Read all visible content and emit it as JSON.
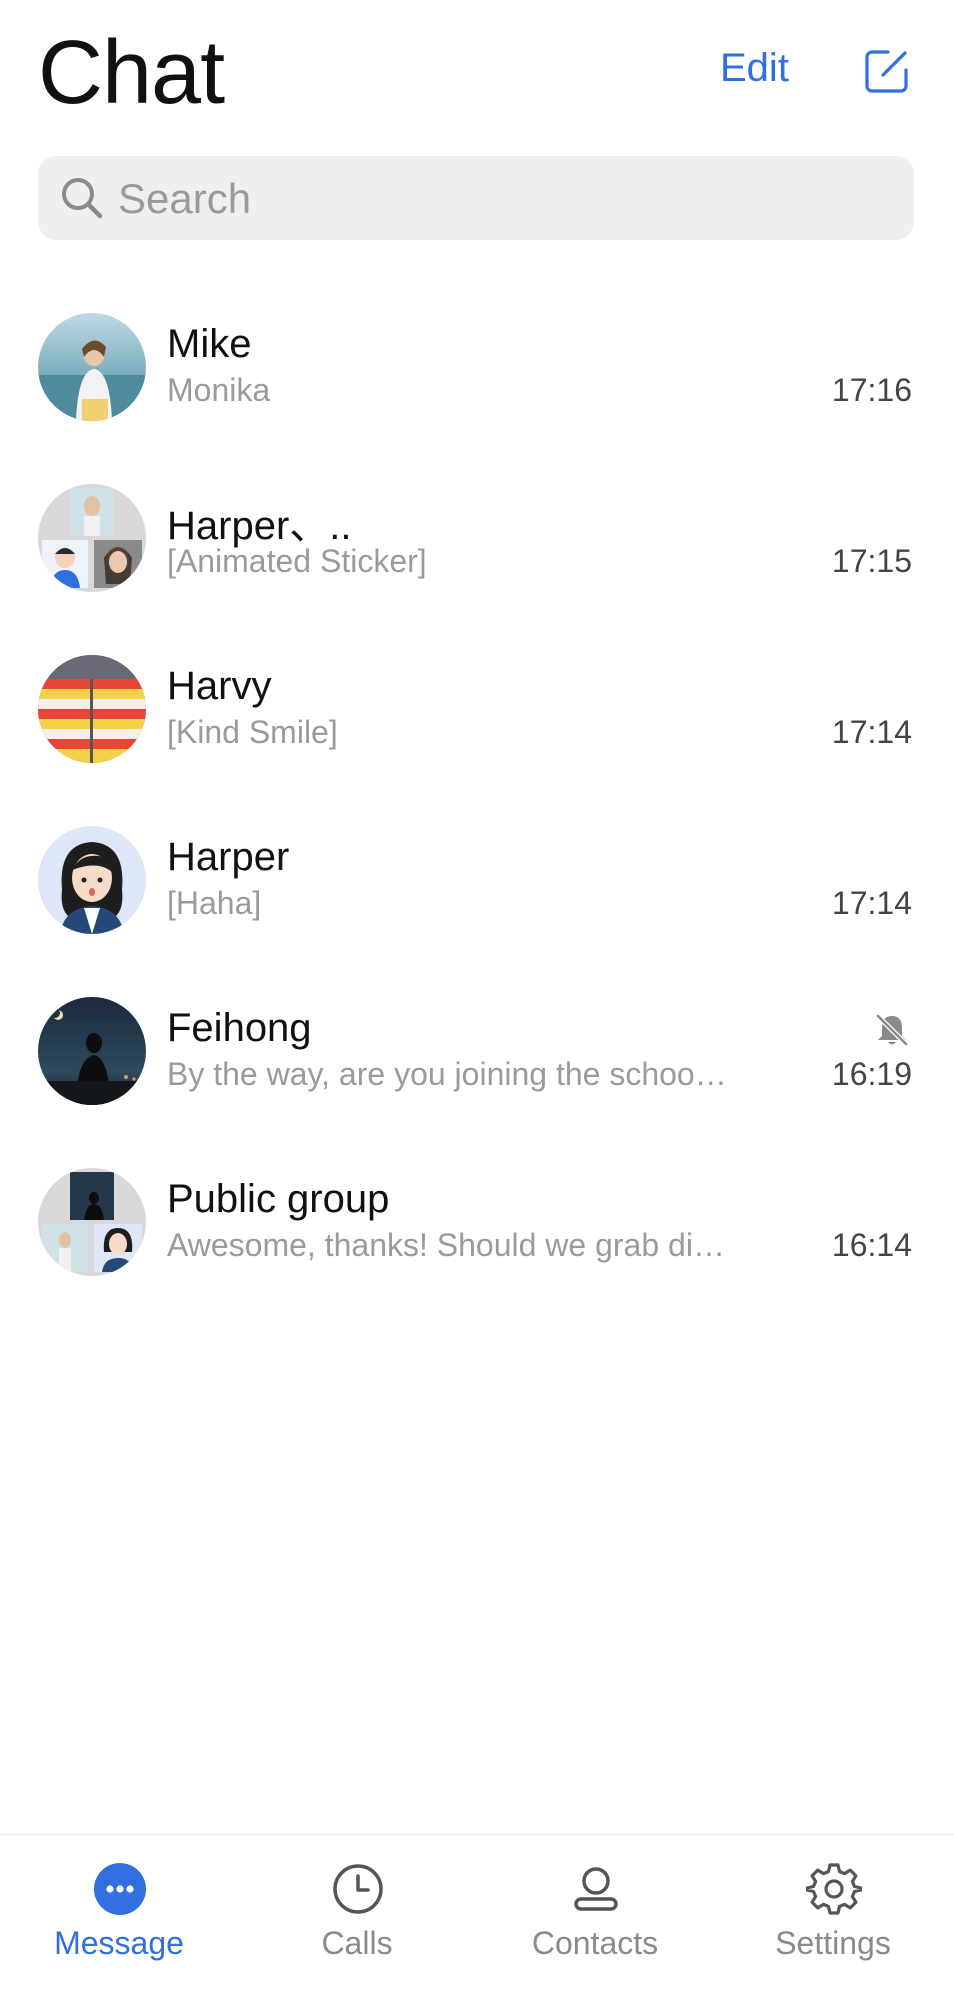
{
  "header": {
    "title": "Chat",
    "edit_label": "Edit",
    "compose_icon": "compose-icon"
  },
  "search": {
    "placeholder": "Search"
  },
  "chats": [
    {
      "name": "Mike",
      "preview": "Monika",
      "time": "17:16",
      "muted": false,
      "avatar": "photo-woman-beach"
    },
    {
      "name": "Harper、..",
      "preview": "[Animated Sticker]",
      "time": "17:15",
      "muted": false,
      "avatar": "group-collage"
    },
    {
      "name": "Harvy",
      "preview": "[Kind Smile]",
      "time": "17:14",
      "muted": false,
      "avatar": "striped-pattern"
    },
    {
      "name": "Harper",
      "preview": "[Haha]",
      "time": "17:14",
      "muted": false,
      "avatar": "cartoon-woman"
    },
    {
      "name": "Feihong",
      "preview": "By the way, are you joining the schoo…",
      "time": "16:19",
      "muted": true,
      "avatar": "night-silhouette"
    },
    {
      "name": "Public group",
      "preview": "Awesome, thanks! Should we grab di…",
      "time": "16:14",
      "muted": false,
      "avatar": "group-collage"
    }
  ],
  "tabbar": {
    "tabs": [
      {
        "label": "Message",
        "icon": "message-icon",
        "active": true
      },
      {
        "label": "Calls",
        "icon": "clock-icon",
        "active": false
      },
      {
        "label": "Contacts",
        "icon": "person-icon",
        "active": false
      },
      {
        "label": "Settings",
        "icon": "gear-icon",
        "active": false
      }
    ]
  },
  "colors": {
    "accent": "#2f6fe0",
    "muted_text": "#9a9a9a",
    "search_bg": "#efefef"
  }
}
